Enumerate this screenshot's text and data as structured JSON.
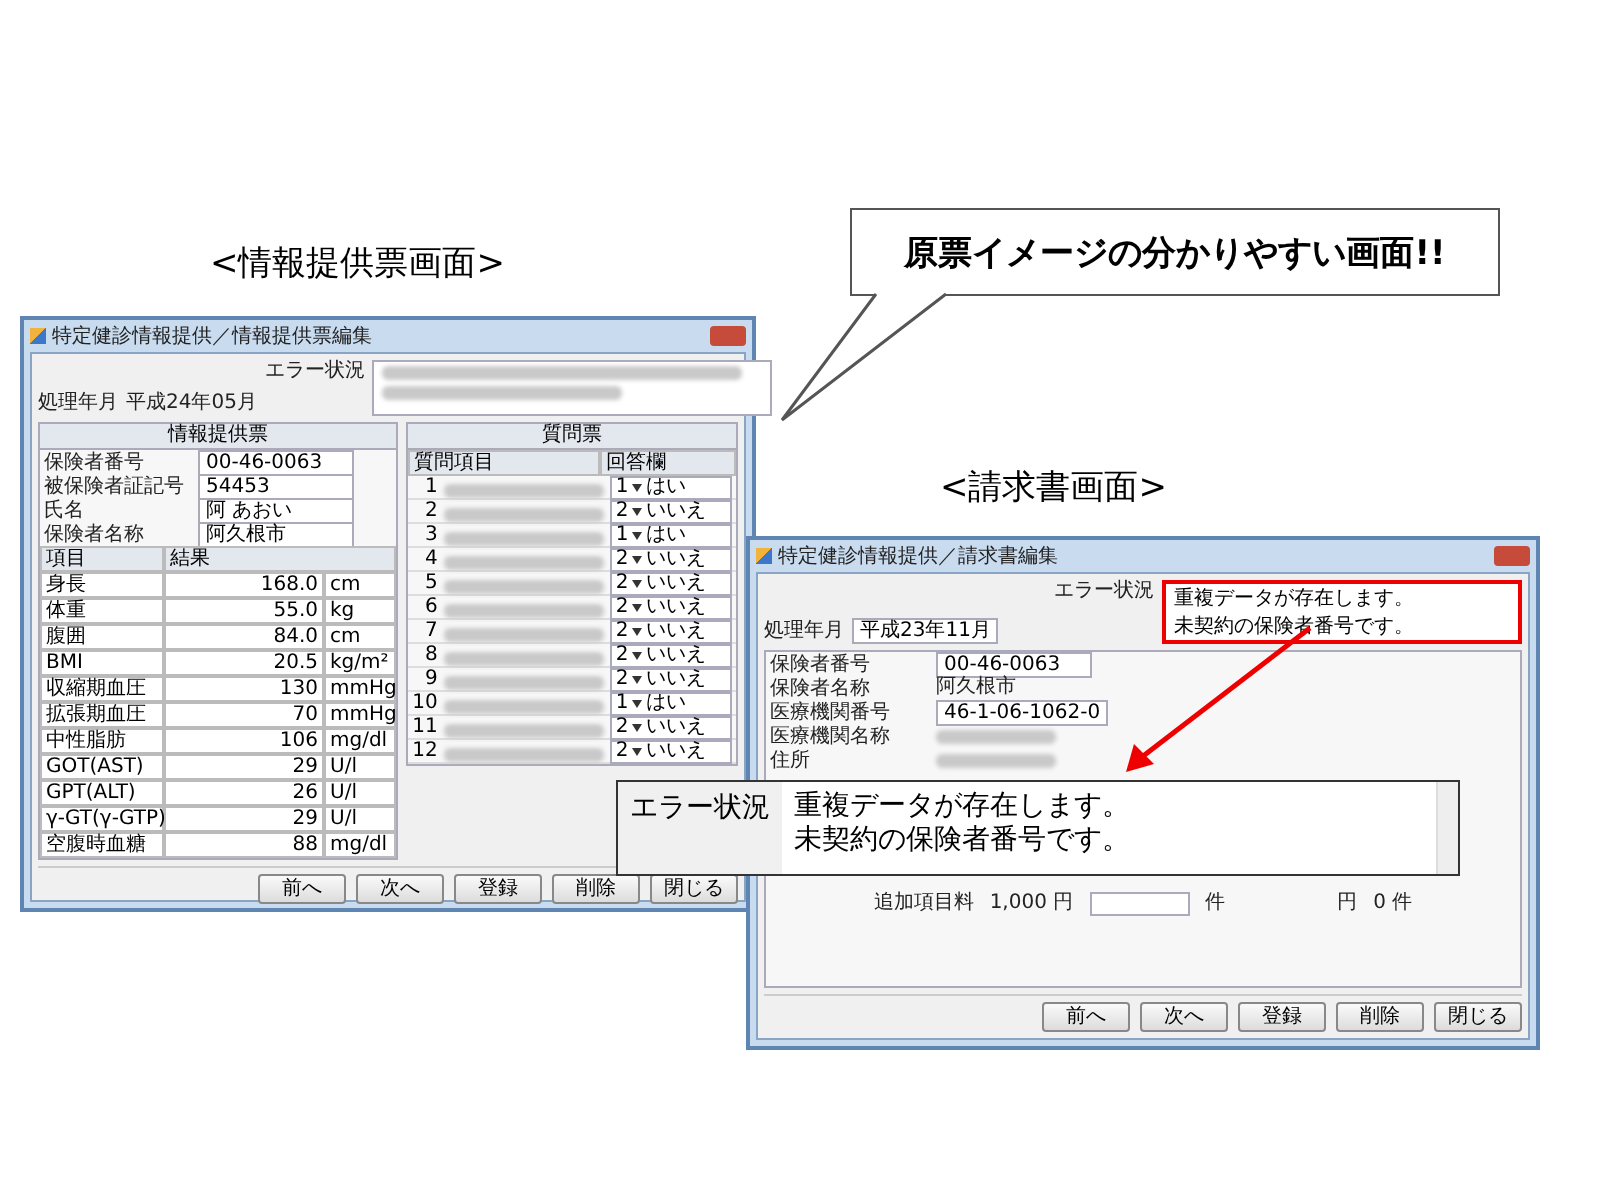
{
  "info_label": "<情報提供票画面>",
  "callout": {
    "text": "原票イメージの分かりやすい画面!!"
  },
  "bill_label": "<請求書画面>",
  "info_window": {
    "title": "特定健診情報提供／情報提供票編集",
    "month_label": "処理年月",
    "month_value": "平成24年05月",
    "error_label": "エラー状況",
    "panel_title": "情報提供票",
    "fields": [
      {
        "label": "保険者番号",
        "value": "00-46-0063"
      },
      {
        "label": "被保険者証記号",
        "value": "54453"
      },
      {
        "label": "氏名",
        "value": "阿 あおい"
      },
      {
        "label": "保険者名称",
        "value": "阿久根市"
      }
    ],
    "measure_columns": [
      "項目",
      "結果"
    ],
    "measures": [
      {
        "item": "身長",
        "result": "168.0",
        "unit": "cm"
      },
      {
        "item": "体重",
        "result": "55.0",
        "unit": "kg"
      },
      {
        "item": "腹囲",
        "result": "84.0",
        "unit": "cm"
      },
      {
        "item": "BMI",
        "result": "20.5",
        "unit": "kg/m²"
      },
      {
        "item": "収縮期血圧",
        "result": "130",
        "unit": "mmHg"
      },
      {
        "item": "拡張期血圧",
        "result": "70",
        "unit": "mmHg"
      },
      {
        "item": "中性脂肪",
        "result": "106",
        "unit": "mg/dl"
      },
      {
        "item": "GOT(AST)",
        "result": "29",
        "unit": "U/l"
      },
      {
        "item": "GPT(ALT)",
        "result": "26",
        "unit": "U/l"
      },
      {
        "item": "γ-GT(γ-GTP)",
        "result": "29",
        "unit": "U/l"
      },
      {
        "item": "空腹時血糖",
        "result": "88",
        "unit": "mg/dl"
      }
    ],
    "question_title": "質問票",
    "question_columns": [
      "質問項目",
      "回答欄"
    ],
    "questions": [
      {
        "no": "1",
        "code": "1",
        "answer": "はい"
      },
      {
        "no": "2",
        "code": "2",
        "answer": "いいえ"
      },
      {
        "no": "3",
        "code": "1",
        "answer": "はい"
      },
      {
        "no": "4",
        "code": "2",
        "answer": "いいえ"
      },
      {
        "no": "5",
        "code": "2",
        "answer": "いいえ"
      },
      {
        "no": "6",
        "code": "2",
        "answer": "いいえ"
      },
      {
        "no": "7",
        "code": "2",
        "answer": "いいえ"
      },
      {
        "no": "8",
        "code": "2",
        "answer": "いいえ"
      },
      {
        "no": "9",
        "code": "2",
        "answer": "いいえ"
      },
      {
        "no": "10",
        "code": "1",
        "answer": "はい"
      },
      {
        "no": "11",
        "code": "2",
        "answer": "いいえ"
      },
      {
        "no": "12",
        "code": "2",
        "answer": "いいえ"
      }
    ],
    "buttons": [
      "前へ",
      "次へ",
      "登録",
      "削除",
      "閉じる"
    ]
  },
  "bill_window": {
    "title": "特定健診情報提供／請求書編集",
    "error_label": "エラー状況",
    "error_lines": [
      "重複データが存在します。",
      "未契約の保険者番号です。"
    ],
    "month_label": "処理年月",
    "month_value": "平成23年11月",
    "fields": [
      {
        "label": "保険者番号",
        "value": "00-46-0063",
        "kind": "input"
      },
      {
        "label": "保険者名称",
        "value": "阿久根市",
        "kind": "text"
      },
      {
        "label": "医療機関番号",
        "value": "46-1-06-1062-0",
        "kind": "input"
      },
      {
        "label": "医療機関名称",
        "kind": "blurred"
      },
      {
        "label": "住所",
        "kind": "blurred"
      }
    ],
    "fee_row": {
      "label": "追加項目料",
      "price": "1,000 円",
      "count_unit": "件",
      "amount_unit": "円",
      "total": "0 件"
    },
    "buttons": [
      "前へ",
      "次へ",
      "登録",
      "削除",
      "閉じる"
    ]
  },
  "zoom_overlay": {
    "label": "エラー状況",
    "lines": [
      "重複データが存在します。",
      "未契約の保険者番号です。"
    ]
  }
}
